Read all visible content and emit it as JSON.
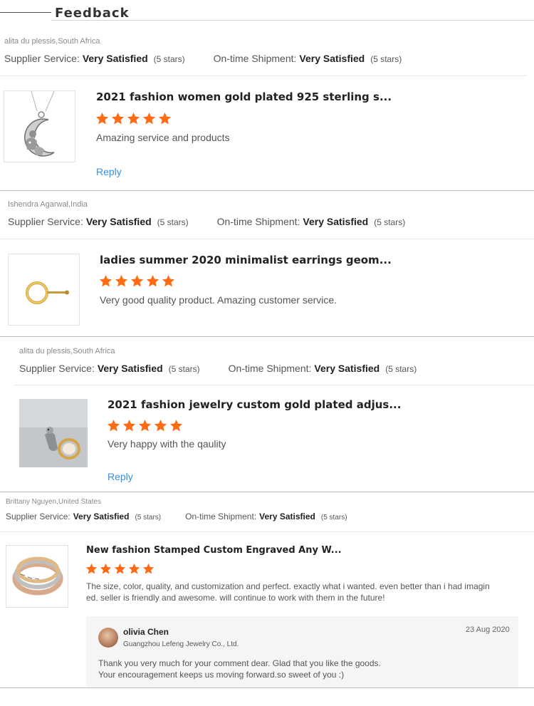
{
  "header": {
    "title": "Feedback"
  },
  "labels": {
    "supplier_service": "Supplier Service:",
    "ontime_shipment": "On-time Shipment:",
    "reply": "Reply"
  },
  "colors": {
    "star": "#ff6a14",
    "link": "#3b8ed8"
  },
  "reviews": [
    {
      "reviewer": "alita du plessis,South Africa",
      "supplier_value": "Very Satisfied",
      "supplier_stars": "(5 stars)",
      "shipment_value": "Very Satisfied",
      "shipment_stars": "(5 stars)",
      "product_title": "2021 fashion women gold plated 925 sterling s...",
      "rating": 5,
      "comment": "Amazing service and products",
      "image": "moon-cat-pendant-necklace"
    },
    {
      "reviewer": "Ishendra Agarwal,India",
      "supplier_value": "Very Satisfied",
      "supplier_stars": "(5 stars)",
      "shipment_value": "Very Satisfied",
      "shipment_stars": "(5 stars)",
      "product_title": "ladies summer 2020 minimalist earrings geom...",
      "rating": 5,
      "comment": "Very good quality product. Amazing customer service.",
      "image": "gold-circle-earring"
    },
    {
      "reviewer": "alita du plessis,South Africa",
      "supplier_value": "Very Satisfied",
      "supplier_stars": "(5 stars)",
      "shipment_value": "Very Satisfied",
      "shipment_stars": "(5 stars)",
      "product_title": "2021 fashion jewelry custom gold plated adjus...",
      "rating": 5,
      "comment": "Very happy with the qaulity",
      "image": "gold-adjustable-ring"
    },
    {
      "reviewer": "Brittany Nguyen,United States",
      "supplier_value": "Very Satisfied",
      "supplier_stars": "(5 stars)",
      "shipment_value": "Very Satisfied",
      "shipment_stars": "(5 stars)",
      "product_title": "New fashion Stamped Custom Engraved Any W...",
      "rating": 5,
      "comment_line1": "The size, color, quality, and customization and perfect. exactly what i wanted. even better than i had imagin",
      "comment_line2": "ed. seller is friendly and awesome. will continue to work with them in the future!",
      "image": "engraved-cuff-bracelets",
      "seller_reply": {
        "name": "olivia Chen",
        "company": "Guangzhou Lefeng Jewelry Co., Ltd.",
        "date": "23 Aug 2020",
        "line1": "Thank you very much for your comment dear. Glad that you like the goods.",
        "line2": "Your encouragement keeps us moving forward.so sweet of you :)"
      }
    }
  ]
}
